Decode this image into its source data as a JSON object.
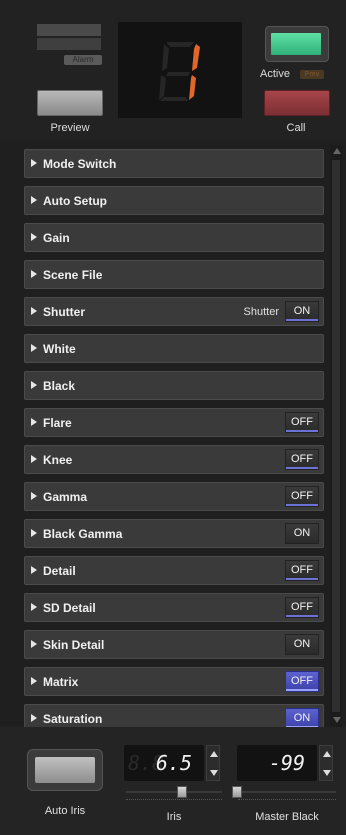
{
  "top": {
    "alarm_label": "Alarm",
    "preview_label": "Preview",
    "camera_number": "1",
    "active_label": "Active",
    "active_badge": "Prev",
    "call_label": "Call"
  },
  "menu": {
    "items": [
      {
        "label": "Mode Switch",
        "extra": "",
        "toggle": ""
      },
      {
        "label": "Auto Setup",
        "extra": "",
        "toggle": ""
      },
      {
        "label": "Gain",
        "extra": "",
        "toggle": ""
      },
      {
        "label": "Scene File",
        "extra": "",
        "toggle": ""
      },
      {
        "label": "Shutter",
        "extra": "Shutter",
        "toggle": "ON"
      },
      {
        "label": "White",
        "extra": "",
        "toggle": ""
      },
      {
        "label": "Black",
        "extra": "",
        "toggle": ""
      },
      {
        "label": "Flare",
        "extra": "",
        "toggle": "OFF"
      },
      {
        "label": "Knee",
        "extra": "",
        "toggle": "OFF"
      },
      {
        "label": "Gamma",
        "extra": "",
        "toggle": "OFF"
      },
      {
        "label": "Black Gamma",
        "extra": "",
        "toggle": "ON"
      },
      {
        "label": "Detail",
        "extra": "",
        "toggle": "OFF"
      },
      {
        "label": "SD Detail",
        "extra": "",
        "toggle": "OFF"
      },
      {
        "label": "Skin Detail",
        "extra": "",
        "toggle": "ON"
      },
      {
        "label": "Matrix",
        "extra": "",
        "toggle": "OFF"
      },
      {
        "label": "Saturation",
        "extra": "",
        "toggle": "ON"
      }
    ]
  },
  "bottom": {
    "auto_iris_label": "Auto Iris",
    "iris_value": "6.5",
    "iris_ghost": "8.8",
    "iris_label": "Iris",
    "master_black_value": "-99",
    "master_black_label": "Master Black"
  },
  "colors": {
    "active_green": "#3fcf8e",
    "call_red": "#8e3a3e",
    "tally_orange": "#e0662a",
    "toggle_blue": "#4a50c0"
  }
}
